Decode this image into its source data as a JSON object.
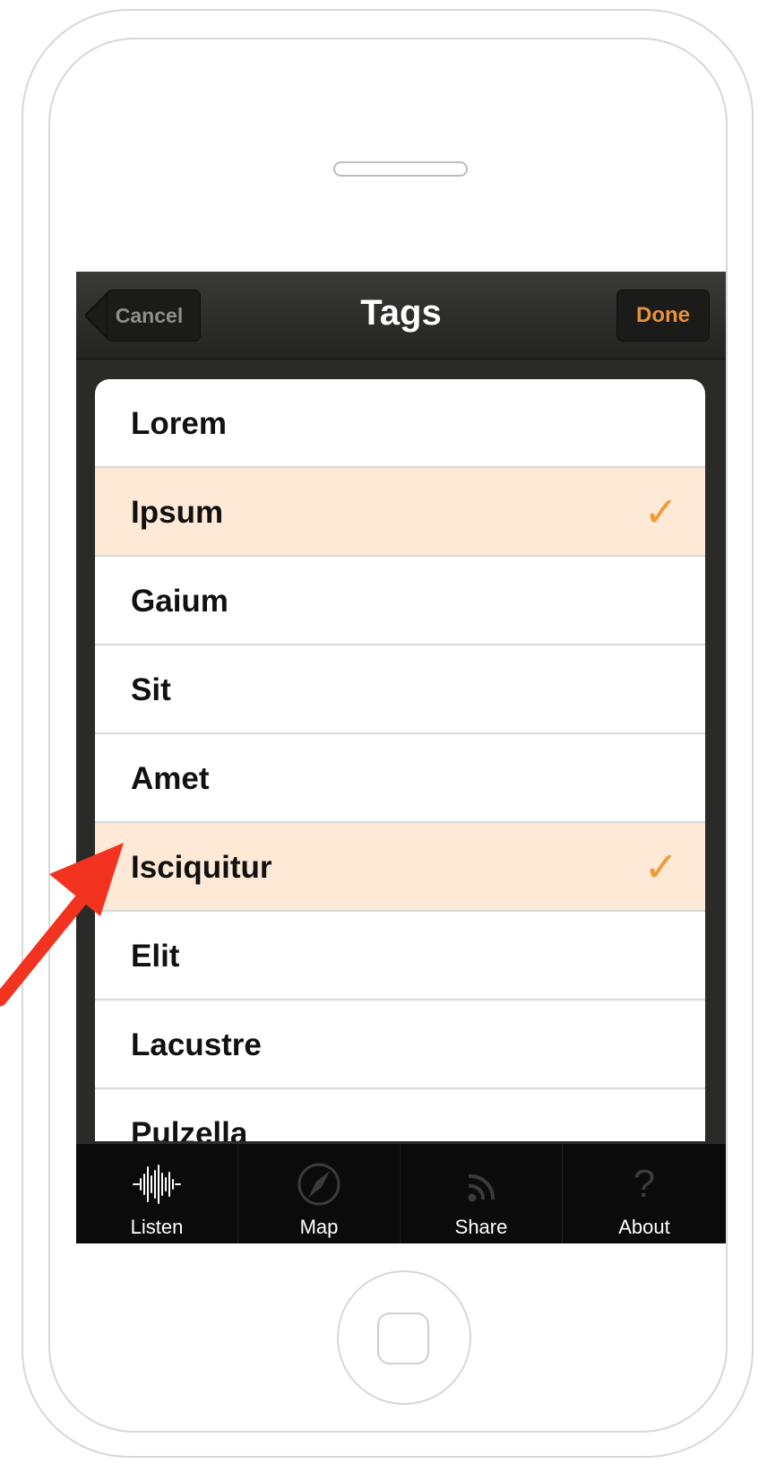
{
  "navbar": {
    "title": "Tags",
    "cancel_label": "Cancel",
    "done_label": "Done"
  },
  "list": {
    "items": [
      {
        "label": "Lorem",
        "selected": false
      },
      {
        "label": "Ipsum",
        "selected": true
      },
      {
        "label": "Gaium",
        "selected": false
      },
      {
        "label": "Sit",
        "selected": false
      },
      {
        "label": "Amet",
        "selected": false
      },
      {
        "label": "Isciquitur",
        "selected": true
      },
      {
        "label": "Elit",
        "selected": false
      },
      {
        "label": "Lacustre",
        "selected": false
      },
      {
        "label": "Pulzella",
        "selected": false
      }
    ],
    "check_glyph": "✓"
  },
  "tabbar": {
    "tabs": [
      {
        "label": "Listen",
        "icon": "waveform-icon",
        "active": true
      },
      {
        "label": "Map",
        "icon": "compass-icon",
        "active": false
      },
      {
        "label": "Share",
        "icon": "rss-icon",
        "active": false
      },
      {
        "label": "About",
        "icon": "question-icon",
        "active": false
      }
    ],
    "about_glyph": "?"
  },
  "colors": {
    "accent": "#ef9b3a",
    "selected_row": "#fde9d5",
    "annotation_arrow": "#f2331f"
  }
}
